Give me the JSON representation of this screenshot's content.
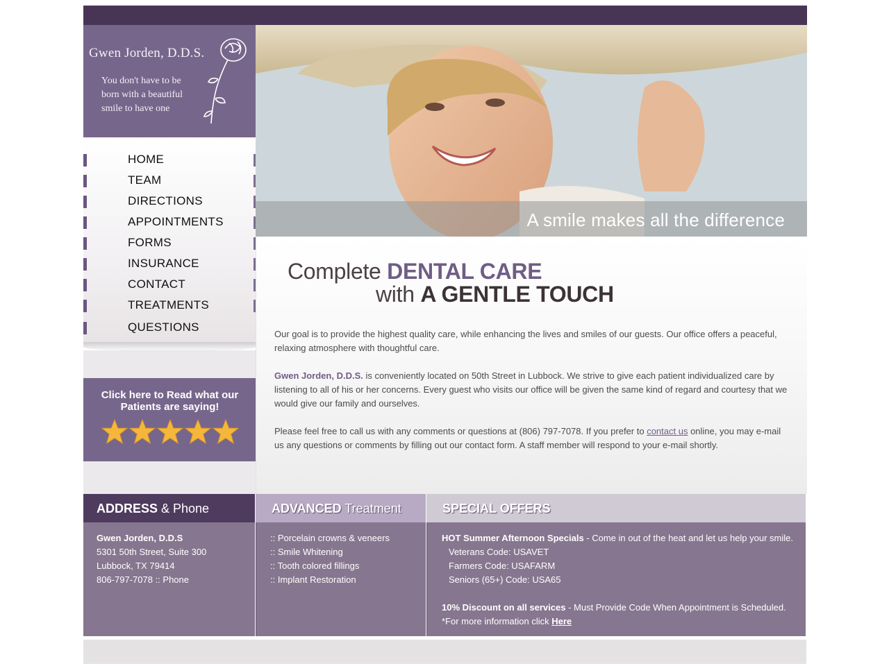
{
  "logo": {
    "name": "Gwen Jorden, D.D.S.",
    "tagline_lines": [
      "You don't have to be",
      "born with a beautiful",
      "smile to have one"
    ],
    "rose_icon": "rose-icon"
  },
  "nav": {
    "items": [
      {
        "label": "HOME"
      },
      {
        "label": "TEAM"
      },
      {
        "label": "DIRECTIONS"
      },
      {
        "label": "APPOINTMENTS"
      },
      {
        "label": "FORMS"
      },
      {
        "label": "INSURANCE"
      },
      {
        "label": "CONTACT"
      },
      {
        "label": "TREATMENTS"
      },
      {
        "label": "QUESTIONS"
      }
    ]
  },
  "reviews": {
    "line1": "Click here to Read what our",
    "line2": "Patients are saying!",
    "rating": 5,
    "star_color": "#f5b73b"
  },
  "hero": {
    "caption": "A smile makes all the difference"
  },
  "main": {
    "headline": {
      "part1_plain": "Complete ",
      "part1_accent": "DENTAL CARE",
      "part2_plain": "with ",
      "part2_strong": "A GENTLE TOUCH"
    },
    "para1": "Our goal is to provide the highest quality care, while enhancing the lives and smiles of our guests. Our office offers a peaceful, relaxing atmosphere with thoughtful care.",
    "para2_name": "Gwen Jorden, D.D.S.",
    "para2_rest": " is conveniently located on 50th Street in Lubbock. We strive to give each patient individualized care by listening to all of his or her concerns. Every guest who visits our office will be given the same kind of regard and courtesy that we would give our family and ourselves.",
    "para3_before": "Please feel free to call us with any comments or questions at (806) 797-7078. If you prefer to ",
    "para3_link": "contact us",
    "para3_after": " online, you may e-mail us any questions or comments by filling out our contact form. A staff member will respond to your e-mail shortly."
  },
  "footer": {
    "address": {
      "title_bold": "ADDRESS",
      "title_rest": " & Phone",
      "name": "Gwen Jorden, D.D.S",
      "street": "5301 50th Street, Suite 300",
      "city": "Lubbock, TX 79414",
      "phone": "806-797-7078 :: Phone"
    },
    "treatment": {
      "title_bold": "ADVANCED",
      "title_rest": " Treatment",
      "items": [
        ":: Porcelain crowns & veneers",
        ":: Smile Whitening",
        ":: Tooth colored fillings",
        ":: Implant Restoration"
      ]
    },
    "offers": {
      "title": "SPECIAL OFFERS",
      "hot_bold": "HOT Summer Afternoon Specials",
      "hot_rest": " - Come in out of the heat and let us help your smile.",
      "codes": [
        "Veterans Code: USAVET",
        "Farmers Code: USAFARM",
        "Seniors (65+) Code: USA65"
      ],
      "discount_bold": "10% Discount on all services",
      "discount_rest": " - Must Provide Code When Appointment is Scheduled.",
      "more_text": "*For more information click ",
      "more_link": "Here"
    }
  },
  "colors": {
    "brand_purple": "#77668b",
    "dark_purple": "#483556",
    "accent_text": "#6f5d85"
  }
}
